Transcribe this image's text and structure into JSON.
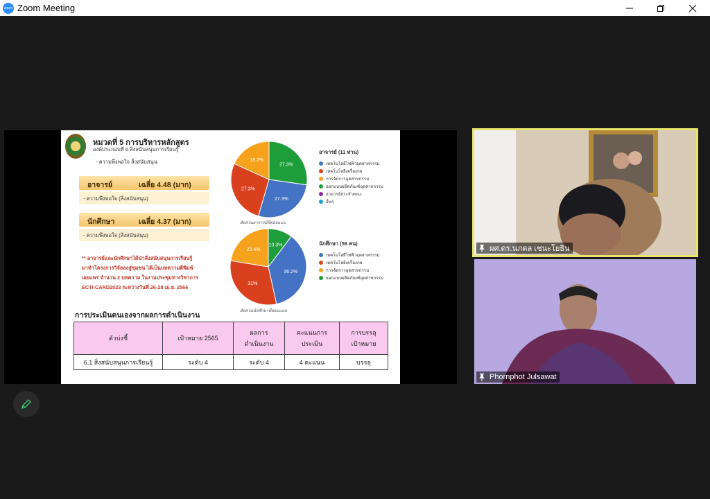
{
  "window": {
    "app_icon_text": "zoom",
    "title": "Zoom Meeting",
    "controls": [
      "minimize-icon",
      "restore-icon",
      "close-icon"
    ]
  },
  "slide": {
    "title": "หมวดที่ 5  การบริหารหลักสูตร",
    "subtitle": "องค์ประกอบที่ 6 สิ่งสนับสนุนการเรียนรู้",
    "satisfaction_heading": "- ความพึงพอใจ สิ่งสนับสนุน",
    "teacher": {
      "label": "อาจารย์",
      "score": "เฉลี่ย 4.48 (มาก)",
      "note": "- ความพึงพอใจ (สิ่งสนับสนุน)"
    },
    "student": {
      "label": "นักศึกษา",
      "score": "เฉลี่ย 4.37 (มาก)",
      "note": "- ความพึงพอใจ (สิ่งสนับสนุน)"
    },
    "red_note": [
      "** อาจารย์และนักศึกษาได้นำสิ่งสนับสนุนการเรียนรู้",
      "มาทำโครงการวิจัยลงสู่ชุมชน ได้เป็นบทความตีพิมพ์",
      "เผยแพร่ จำนวน 2 บทความ ในงานประชุมทางวิชาการ",
      "ECTI-CARD2023 ระหว่างวันที่ 26-28 เม.ย. 2566"
    ],
    "eval_title": "การประเมินตนเองจากผลการดำเนินงาน",
    "table": {
      "headers": [
        "ตัวบ่งชี้",
        "เป้าหมาย 2565",
        "ผลการ\nดำเนินงาน",
        "คะแนนการ\nประเมิน",
        "การบรรลุ\nเป้าหมาย"
      ],
      "rows": [
        [
          "6.1 สิ่งสนับสนุนการเรียนรู้",
          "ระดับ 4",
          "ระดับ 4",
          "4 คะแนน",
          "บรรลุ"
        ]
      ]
    }
  },
  "chart_data": [
    {
      "type": "pie",
      "title": "อาจารย์ (11 ท่าน)",
      "caption": "สัดส่วนอาจารย์ที่ตอบแบบ",
      "slices": [
        {
          "label": "เทคโนโลยีไฟฟ้าอุตสาหกรรม",
          "value": 27.3,
          "text": "27.3%",
          "color": "#4472c4"
        },
        {
          "label": "เทคโนโลยีเครื่องกล",
          "value": 27.3,
          "text": "27.3%",
          "color": "#d9401e"
        },
        {
          "label": "การจัดการอุตสาหกรรม",
          "value": 18.2,
          "text": "18.2%",
          "color": "#f6a21d"
        },
        {
          "label": "ออกแบบผลิตภัณฑ์อุตสาหกรรม",
          "value": 27.3,
          "text": "27.3%",
          "color": "#1e9e3a"
        },
        {
          "label": "อาจารย์ประจำคณะ",
          "value": 0,
          "text": "",
          "color": "#8e24aa"
        },
        {
          "label": "อื่นๆ",
          "value": 0,
          "text": "",
          "color": "#1ba1c9"
        }
      ]
    },
    {
      "type": "pie",
      "title": "นักศึกษา (58 คน)",
      "caption": "สัดส่วนนักศึกษาที่ตอบแบบ",
      "slices": [
        {
          "label": "เทคโนโลยีไฟฟ้าอุตสาหกรรม",
          "value": 36.2,
          "text": "36.2%",
          "color": "#4472c4"
        },
        {
          "label": "เทคโนโลยีเครื่องกล",
          "value": 31,
          "text": "31%",
          "color": "#d9401e"
        },
        {
          "label": "การจัดการอุตสาหกรรม",
          "value": 22.4,
          "text": "22.4%",
          "color": "#f6a21d"
        },
        {
          "label": "ออกแบบผลิตภัณฑ์อุตสาหกรรม",
          "value": 10.3,
          "text": "10.3%",
          "color": "#1e9e3a"
        }
      ]
    }
  ],
  "participants": [
    {
      "name": "ผศ.ดร.นภดล เชนะโยธิน",
      "active_speaker": true
    },
    {
      "name": "Phornphot Julsawat",
      "active_speaker": false
    }
  ],
  "colors": {
    "active_speaker_border": "#e8e56b",
    "accent": "#2d8cff"
  }
}
